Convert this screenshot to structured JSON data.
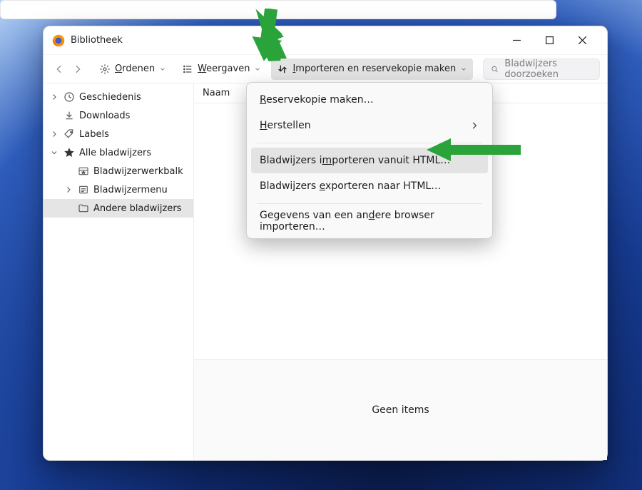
{
  "window": {
    "title": "Bibliotheek"
  },
  "toolbar": {
    "organize_label": "Ordenen",
    "views_label": "Weergaven",
    "import_label": "Importeren en reservekopie maken",
    "search_placeholder": "Bladwijzers doorzoeken"
  },
  "sidebar": {
    "items": [
      {
        "label": "Geschiedenis"
      },
      {
        "label": "Downloads"
      },
      {
        "label": "Labels"
      },
      {
        "label": "Alle bladwijzers"
      },
      {
        "label": "Bladwijzerwerkbalk"
      },
      {
        "label": "Bladwijzermenu"
      },
      {
        "label": "Andere bladwijzers"
      }
    ]
  },
  "main": {
    "column_header": "Naam",
    "empty_label": "Geen items"
  },
  "menu": {
    "items": [
      {
        "pre": "",
        "u": "R",
        "post": "eservekopie maken…"
      },
      {
        "pre": "",
        "u": "H",
        "post": "erstellen",
        "submenu": true
      },
      {
        "pre": "Bladwijzers i",
        "u": "m",
        "post": "porteren vanuit HTML…",
        "hover": true
      },
      {
        "pre": "Bladwijzers ",
        "u": "e",
        "post": "xporteren naar HTML…"
      },
      {
        "pre": "Gegevens van een an",
        "u": "d",
        "post": "ere browser importeren…"
      }
    ]
  },
  "colors": {
    "accent_arrow": "#2aa33a"
  }
}
